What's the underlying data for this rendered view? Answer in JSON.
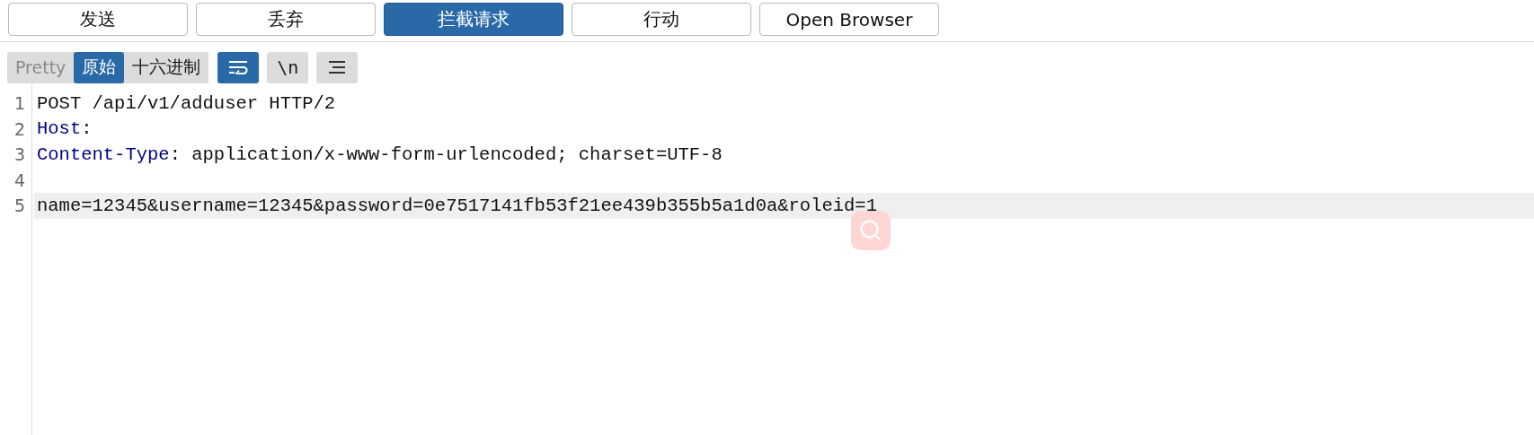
{
  "actions": [
    {
      "label": "发送",
      "selected": false
    },
    {
      "label": "丢弃",
      "selected": false
    },
    {
      "label": "拦截请求",
      "selected": true
    },
    {
      "label": "行动",
      "selected": false
    },
    {
      "label": "Open Browser",
      "selected": false
    }
  ],
  "view_tabs": [
    {
      "label": "Pretty",
      "selected": false,
      "disabled": true
    },
    {
      "label": "原始",
      "selected": true,
      "disabled": false
    },
    {
      "label": "十六进制",
      "selected": false,
      "disabled": false
    }
  ],
  "tools": [
    {
      "kind": "wrap",
      "on": true
    },
    {
      "kind": "newline",
      "label": "\\n",
      "on": false
    },
    {
      "kind": "menu",
      "on": false
    }
  ],
  "lines": [
    {
      "number": "1",
      "current": false,
      "segments": [
        {
          "kind": "text",
          "text": "POST /api/v1/adduser HTTP/2"
        }
      ]
    },
    {
      "number": "2",
      "current": false,
      "segments": [
        {
          "kind": "header-name",
          "text": "Host"
        },
        {
          "kind": "text",
          "text": ":"
        }
      ]
    },
    {
      "number": "3",
      "current": false,
      "segments": [
        {
          "kind": "header-name",
          "text": "Content-Type"
        },
        {
          "kind": "text",
          "text": ": application/x-www-form-urlencoded; charset=UTF-8"
        }
      ]
    },
    {
      "number": "4",
      "current": false
    },
    {
      "number": "5",
      "current": true,
      "segments": [
        {
          "kind": "text",
          "text": "name=12345&username=12345&password=0e7517141fb53f21ee439b355b5a1d0a&roleid=1"
        }
      ]
    }
  ]
}
